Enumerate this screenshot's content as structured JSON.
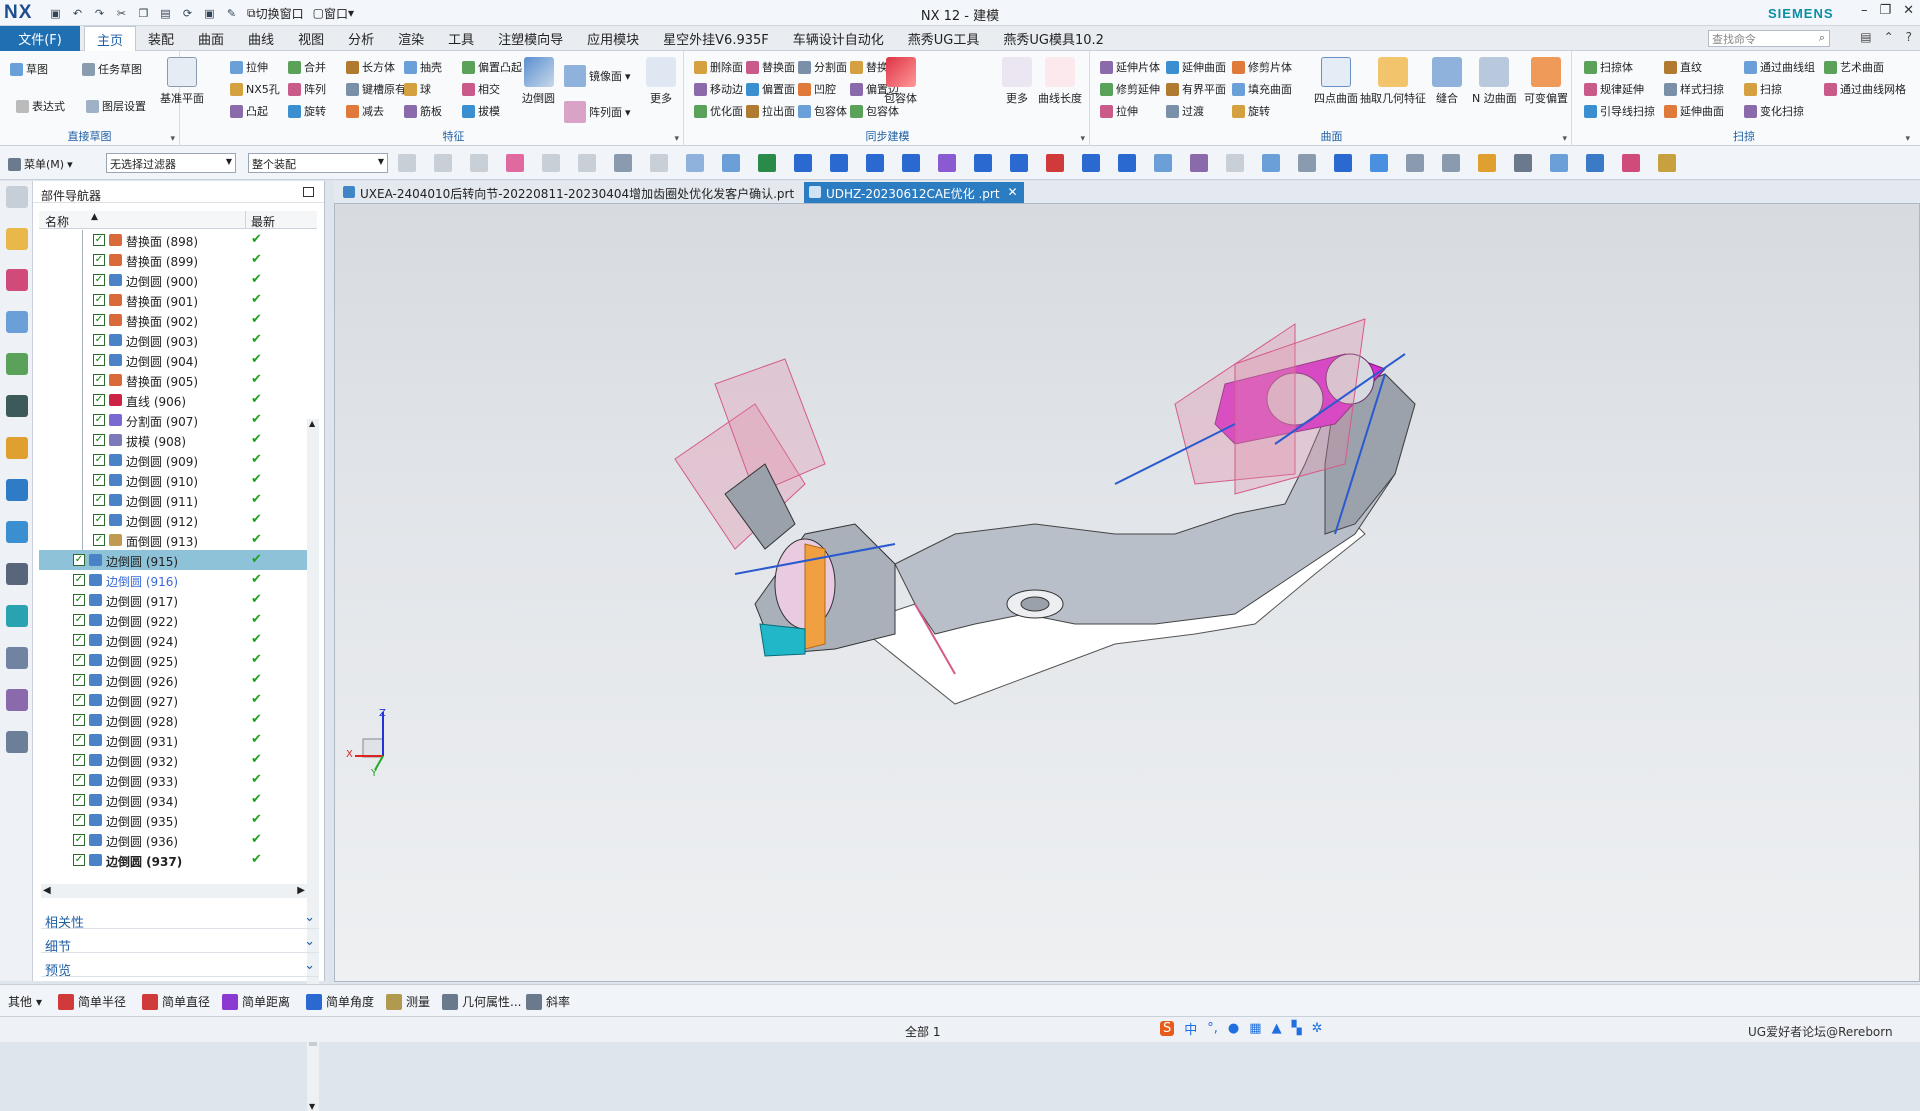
{
  "app": {
    "logo": "NX",
    "title": "NX 12 - 建模",
    "brand": "SIEMENS",
    "switch_window": "切换窗口",
    "window_menu": "窗口"
  },
  "menubar": {
    "file_tab": "文件(F)",
    "tabs": [
      "主页",
      "装配",
      "曲面",
      "曲线",
      "视图",
      "分析",
      "渲染",
      "工具",
      "注塑模向导",
      "应用模块",
      "星空外挂V6.935F",
      "车辆设计自动化",
      "燕秀UG工具",
      "燕秀UG模具10.2"
    ],
    "active_tab": "主页",
    "search_placeholder": "查找命令"
  },
  "ribbon": {
    "groups": [
      {
        "title": "直接草图",
        "small": [
          "草图",
          "任务草图",
          "表达式",
          "图层设置"
        ],
        "big": [
          "基准平面"
        ]
      },
      {
        "title": "特征",
        "small": [
          "拉伸",
          "NX5孔",
          "凸起",
          "合并",
          "阵列",
          "旋转",
          "长方体",
          "键槽原有",
          "减去",
          "抽壳",
          "球",
          "筋板",
          "偏置凸起",
          "相交",
          "拔模"
        ],
        "big": [
          "边倒圆",
          "镜像面",
          "阵列面",
          "更多"
        ]
      },
      {
        "title": "同步建模",
        "small": [
          "删除面",
          "移动边",
          "优化面",
          "替换面",
          "偏置面",
          "拉出面",
          "分割面",
          "凹腔",
          "包容体",
          "替换面",
          "偏置边",
          "包容体"
        ],
        "big": [
          "包容体",
          "更多",
          "曲线长度"
        ]
      },
      {
        "title": "曲面",
        "small": [
          "延伸片体",
          "修剪延伸",
          "拉伸",
          "延伸曲面",
          "有界平面",
          "过渡",
          "修剪片体",
          "填充曲面",
          "旋转"
        ],
        "big": [
          "四点曲面",
          "抽取几何特征",
          "缝合",
          "N 边曲面",
          "可变偏置"
        ]
      },
      {
        "title": "扫掠",
        "small": [
          "扫掠体",
          "规律延伸",
          "引导线扫掠",
          "直纹",
          "样式扫掠",
          "延伸曲面",
          "通过曲线组",
          "扫掠",
          "变化扫掠",
          "艺术曲面",
          "通过曲线网格"
        ]
      }
    ]
  },
  "toolbar2": {
    "menu": "菜单(M)",
    "filter": "无选择过滤器",
    "assembly": "整个装配"
  },
  "navigator": {
    "title": "部件导航器",
    "col_name": "名称",
    "col_latest": "最新",
    "rows": [
      {
        "label": "替换面 (898)",
        "type": "replace",
        "indent": 1
      },
      {
        "label": "替换面 (899)",
        "type": "replace",
        "indent": 1
      },
      {
        "label": "边倒圆 (900)",
        "type": "blend",
        "indent": 1
      },
      {
        "label": "替换面 (901)",
        "type": "replace",
        "indent": 1
      },
      {
        "label": "替换面 (902)",
        "type": "replace",
        "indent": 1
      },
      {
        "label": "边倒圆 (903)",
        "type": "blend",
        "indent": 1
      },
      {
        "label": "边倒圆 (904)",
        "type": "blend",
        "indent": 1
      },
      {
        "label": "替换面 (905)",
        "type": "replace",
        "indent": 1
      },
      {
        "label": "直线 (906)",
        "type": "line",
        "indent": 1
      },
      {
        "label": "分割面 (907)",
        "type": "split",
        "indent": 1
      },
      {
        "label": "拔模 (908)",
        "type": "draft",
        "indent": 1
      },
      {
        "label": "边倒圆 (909)",
        "type": "blend",
        "indent": 1
      },
      {
        "label": "边倒圆 (910)",
        "type": "blend",
        "indent": 1
      },
      {
        "label": "边倒圆 (911)",
        "type": "blend",
        "indent": 1
      },
      {
        "label": "边倒圆 (912)",
        "type": "blend",
        "indent": 1
      },
      {
        "label": "面倒圆 (913)",
        "type": "face",
        "indent": 1
      },
      {
        "label": "边倒圆 (915)",
        "type": "blend",
        "indent": 0,
        "selected": true
      },
      {
        "label": "边倒圆 (916)",
        "type": "blend",
        "indent": 0,
        "link": true
      },
      {
        "label": "边倒圆 (917)",
        "type": "blend",
        "indent": 0
      },
      {
        "label": "边倒圆 (922)",
        "type": "blend",
        "indent": 0
      },
      {
        "label": "边倒圆 (924)",
        "type": "blend",
        "indent": 0
      },
      {
        "label": "边倒圆 (925)",
        "type": "blend",
        "indent": 0
      },
      {
        "label": "边倒圆 (926)",
        "type": "blend",
        "indent": 0
      },
      {
        "label": "边倒圆 (927)",
        "type": "blend",
        "indent": 0
      },
      {
        "label": "边倒圆 (928)",
        "type": "blend",
        "indent": 0
      },
      {
        "label": "边倒圆 (931)",
        "type": "blend",
        "indent": 0
      },
      {
        "label": "边倒圆 (932)",
        "type": "blend",
        "indent": 0
      },
      {
        "label": "边倒圆 (933)",
        "type": "blend",
        "indent": 0
      },
      {
        "label": "边倒圆 (934)",
        "type": "blend",
        "indent": 0
      },
      {
        "label": "边倒圆 (935)",
        "type": "blend",
        "indent": 0
      },
      {
        "label": "边倒圆 (936)",
        "type": "blend",
        "indent": 0
      },
      {
        "label": "边倒圆 (937)",
        "type": "blend",
        "indent": 0,
        "bold": true
      }
    ],
    "sections": [
      "相关性",
      "细节",
      "预览"
    ]
  },
  "doc_tabs": [
    {
      "label": "UXEA-2404010后转向节-20220811-20230404增加齿圈处优化发客户确认.prt",
      "active": false
    },
    {
      "label": "UDHZ-20230612CAE优化 .prt",
      "active": true
    }
  ],
  "axes": {
    "z": "Z",
    "x": "X",
    "y": "Y"
  },
  "bottom_tools": {
    "other": "其他",
    "items": [
      "简单半径",
      "简单直径",
      "简单距离",
      "简单角度",
      "测量",
      "几何属性...",
      "斜率"
    ]
  },
  "status": {
    "center": "全部 1",
    "watermark": "UG爱好者论坛@Rereborn"
  },
  "colors": {
    "accent": "#1f6fb2",
    "selection": "#8ec2d8",
    "magenta": "#d42fcf",
    "check": "#1aa31a"
  }
}
